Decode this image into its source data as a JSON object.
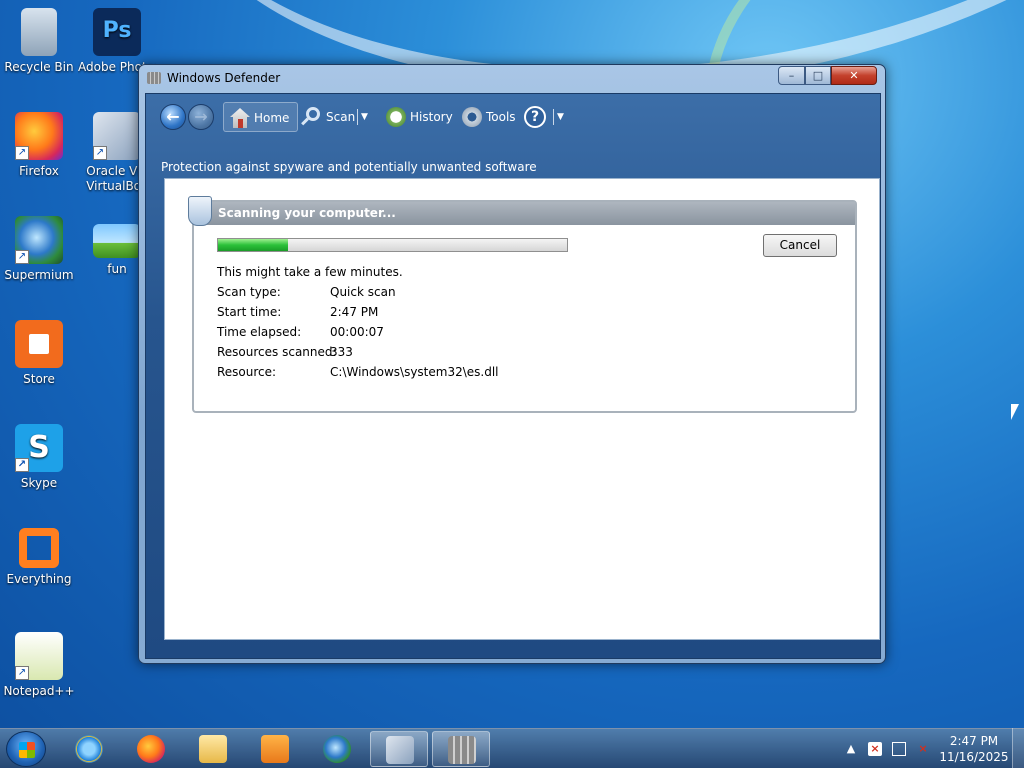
{
  "desktop": {
    "icons": [
      {
        "label": "Recycle Bin",
        "icon": "recycle-bin-icon"
      },
      {
        "label": "Adobe Photosh...",
        "icon": "photoshop-icon"
      },
      {
        "label": "Firefox",
        "icon": "firefox-icon"
      },
      {
        "label": "Oracle VM VirtualBox",
        "icon": "virtualbox-icon"
      },
      {
        "label": "Supermium",
        "icon": "supermium-icon"
      },
      {
        "label": "fun",
        "icon": "image-file-icon"
      },
      {
        "label": "Store",
        "icon": "store-icon"
      },
      {
        "label": "Skype",
        "icon": "skype-icon"
      },
      {
        "label": "Everything",
        "icon": "everything-icon"
      },
      {
        "label": "Notepad++",
        "icon": "notepadpp-icon"
      }
    ],
    "ps_glyph": "Ps",
    "skype_glyph": "S"
  },
  "window": {
    "title": "Windows Defender",
    "controls": {
      "minimize": "–",
      "maximize": "□",
      "close": "✕"
    },
    "toolbar": {
      "back": "←",
      "forward": "→",
      "home": "Home",
      "scan": "Scan",
      "history": "History",
      "tools": "Tools",
      "help": "?",
      "dropdown": "▼"
    },
    "subtitle": "Protection against spyware and potentially unwanted software",
    "scan": {
      "header": "Scanning your computer...",
      "progress": 0.2,
      "cancel": "Cancel",
      "message": "This might take a few minutes.",
      "rows": [
        {
          "label": "Scan type:",
          "value": "Quick scan"
        },
        {
          "label": "Start time:",
          "value": "2:47 PM"
        },
        {
          "label": "Time elapsed:",
          "value": "00:00:07"
        },
        {
          "label": "Resources scanned:",
          "value": "333"
        },
        {
          "label": "Resource:",
          "value": "C:\\Windows\\system32\\es.dll"
        }
      ]
    }
  },
  "taskbar": {
    "items": [
      "start-button",
      "internet-explorer-icon",
      "firefox-icon",
      "file-explorer-icon",
      "media-player-icon",
      "supermium-icon",
      "virtualbox-icon",
      "windows-defender-icon"
    ],
    "tray": {
      "expand": "▲"
    },
    "clock": {
      "time": "2:47 PM",
      "date": "11/16/2025"
    }
  },
  "colors": {
    "progress_fill": "#2bc13a",
    "close_button": "#c4412c"
  }
}
